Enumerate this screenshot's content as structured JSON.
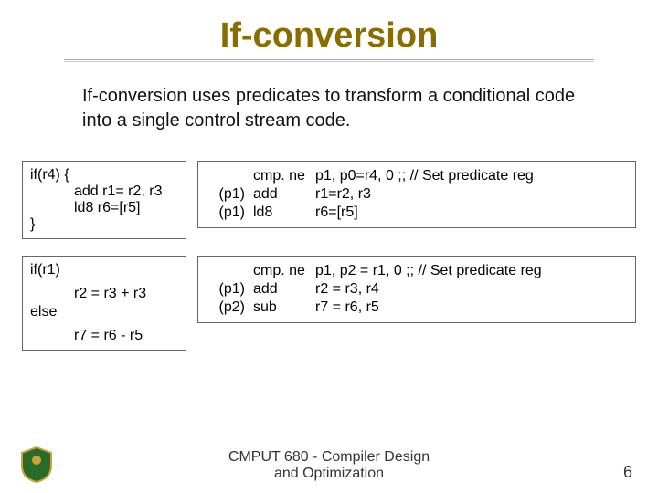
{
  "title": "If-conversion",
  "intro": "If-conversion uses predicates to transform a conditional code into a single control stream code.",
  "example1": {
    "left": {
      "header": "if(r4) {",
      "line1": "add r1= r2, r3",
      "line2": "ld8 r6=[r5]",
      "footer": "}"
    },
    "right": {
      "r1": {
        "pred": "",
        "op": "cmp. ne",
        "rest": "p1, p0=r4, 0 ;; // Set predicate reg"
      },
      "r2": {
        "pred": "(p1)",
        "op": "add",
        "rest": "r1=r2, r3"
      },
      "r3": {
        "pred": "(p1)",
        "op": "ld8",
        "rest": "r6=[r5]"
      }
    }
  },
  "example2": {
    "left": {
      "header": "if(r1)",
      "line1": "r2 = r3 + r3",
      "elselabel": "else",
      "line2": "r7 = r6 - r5"
    },
    "right": {
      "r1": {
        "pred": "",
        "op": "cmp. ne",
        "rest": "p1, p2 = r1, 0 ;; // Set predicate reg"
      },
      "r2": {
        "pred": "(p1)",
        "op": "add",
        "rest": "r2 = r3, r4"
      },
      "r3": {
        "pred": "(p2)",
        "op": "sub",
        "rest": "r7 = r6, r5"
      }
    }
  },
  "footer_line1": "CMPUT 680 - Compiler Design",
  "footer_line2": "and Optimization",
  "pagenum": "6"
}
